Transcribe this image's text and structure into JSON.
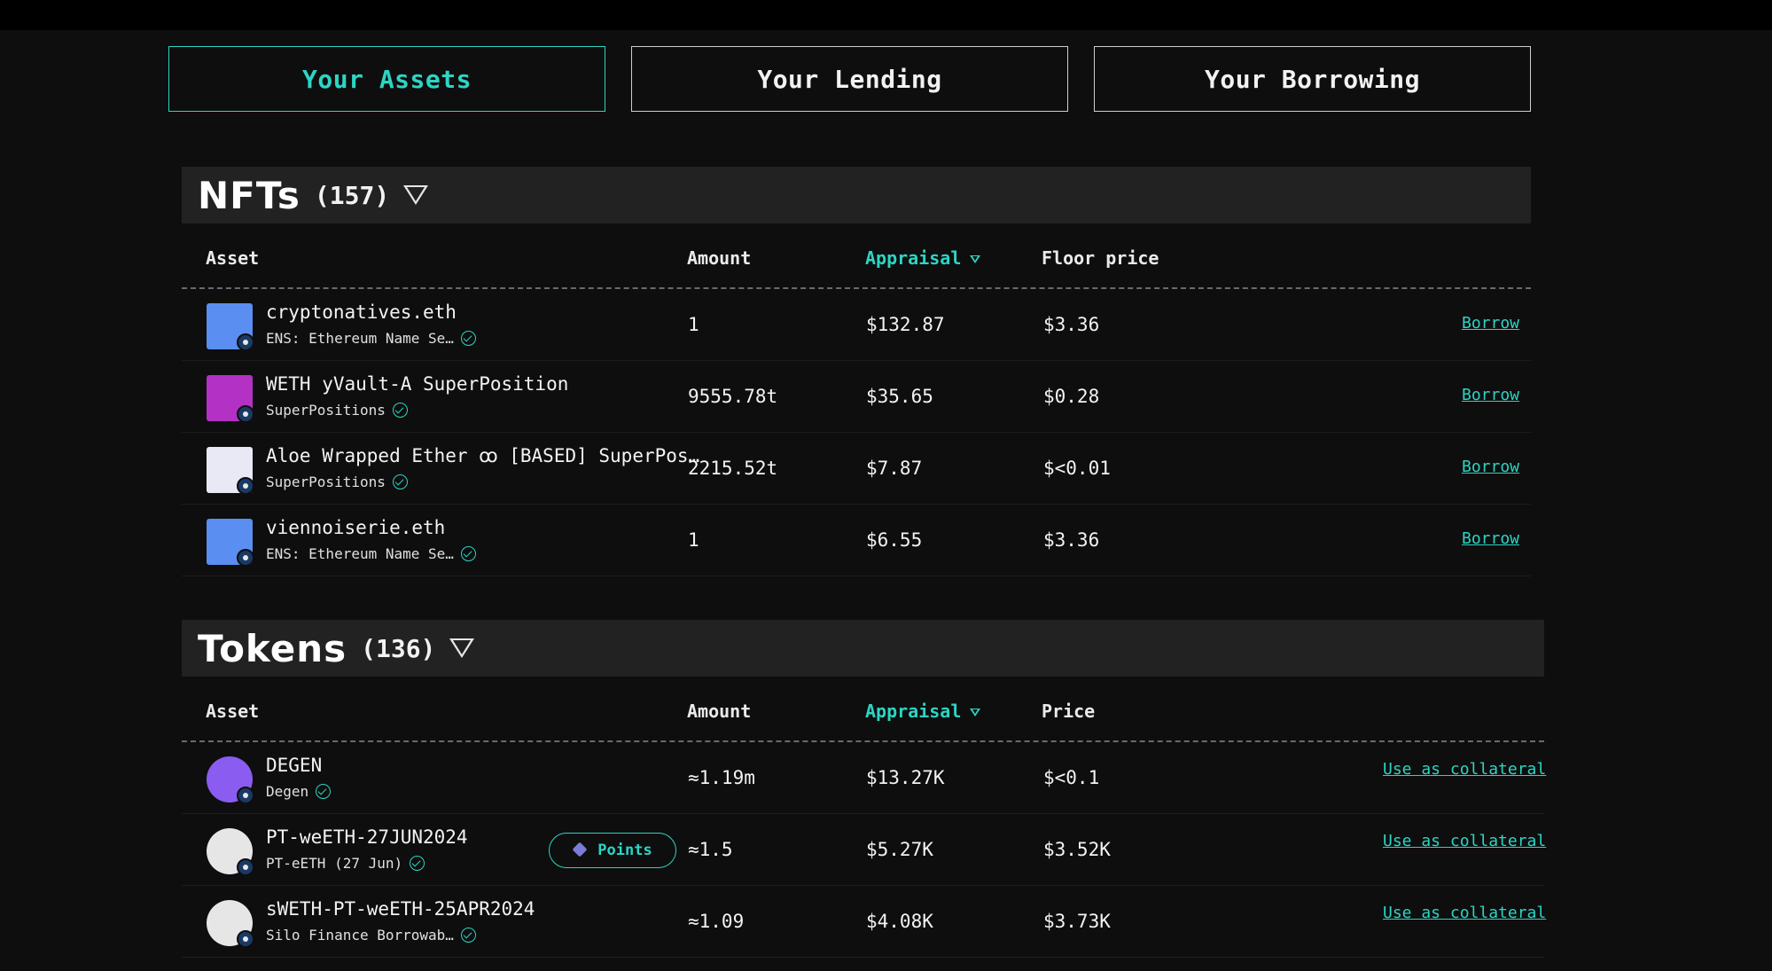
{
  "tabs": [
    {
      "label": "Your Assets",
      "active": true
    },
    {
      "label": "Your Lending",
      "active": false
    },
    {
      "label": "Your Borrowing",
      "active": false
    }
  ],
  "nfts": {
    "title": "NFTs",
    "count": "(157)",
    "columns": {
      "asset": "Asset",
      "amount": "Amount",
      "appraisal": "Appraisal",
      "price": "Floor price"
    },
    "rows": [
      {
        "name": "cryptonatives.eth",
        "collection": "ENS: Ethereum Name Se…",
        "amount": "1",
        "appraisal": "$132.87",
        "price": "$3.36",
        "action": "Borrow",
        "thumb_color": "#5a8ef0"
      },
      {
        "name": "WETH yVault-A SuperPosition",
        "collection": "SuperPositions",
        "amount": "9555.78t",
        "appraisal": "$35.65",
        "price": "$0.28",
        "action": "Borrow",
        "thumb_color": "#b331c4"
      },
      {
        "name": "Aloe Wrapped Ether ꝏ [BASED] SuperPos…",
        "collection": "SuperPositions",
        "amount": "2215.52t",
        "appraisal": "$7.87",
        "price": "$<0.01",
        "action": "Borrow",
        "thumb_color": "#e9e9f5"
      },
      {
        "name": "viennoiserie.eth",
        "collection": "ENS: Ethereum Name Se…",
        "amount": "1",
        "appraisal": "$6.55",
        "price": "$3.36",
        "action": "Borrow",
        "thumb_color": "#5a8ef0"
      }
    ]
  },
  "tokens": {
    "title": "Tokens",
    "count": "(136)",
    "columns": {
      "asset": "Asset",
      "amount": "Amount",
      "appraisal": "Appraisal",
      "price": "Price"
    },
    "rows": [
      {
        "name": "DEGEN",
        "collection": "Degen",
        "amount": "≈1.19m",
        "appraisal": "$13.27K",
        "price": "$<0.1",
        "action": "Use as collateral",
        "thumb_color": "#8a5cf0"
      },
      {
        "name": "PT-weETH-27JUN2024",
        "collection": "PT-eETH (27 Jun)",
        "amount": "≈1.5",
        "appraisal": "$5.27K",
        "price": "$3.52K",
        "action": "Use as collateral",
        "badge": "Points",
        "thumb_color": "#e6e6e6"
      },
      {
        "name": "sWETH-PT-weETH-25APR2024",
        "collection": "Silo Finance Borrowab…",
        "amount": "≈1.09",
        "appraisal": "$4.08K",
        "price": "$3.73K",
        "action": "Use as collateral",
        "thumb_color": "#e6e6e6"
      }
    ]
  },
  "colors": {
    "accent": "#2cd5c4",
    "background": "#0e0e0e",
    "section_header": "#222222"
  }
}
